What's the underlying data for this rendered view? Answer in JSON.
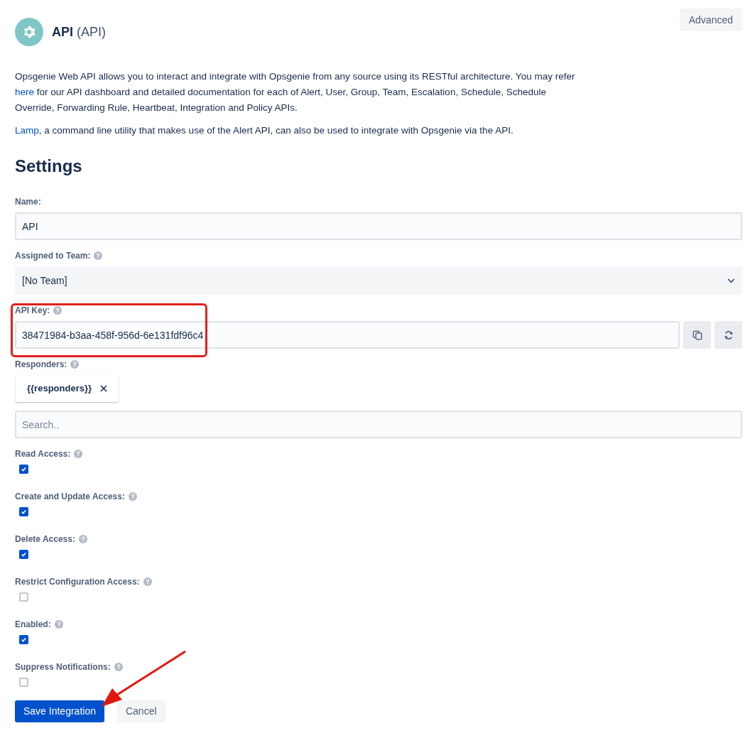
{
  "header": {
    "title": "API",
    "subtitle": "(API)",
    "advanced_button": "Advanced"
  },
  "description": [
    [
      {
        "kind": "text",
        "text": "Opsgenie Web API allows you to interact and integrate with Opsgenie from any source using its RESTful architecture. You may refer "
      },
      {
        "kind": "link",
        "text": "here"
      },
      {
        "kind": "text",
        "text": " for our API dashboard and detailed documentation for each of Alert, User, Group, Team, Escalation, Schedule, Schedule Override, Forwarding Rule, Heartbeat, Integration and Policy APIs."
      }
    ],
    [
      {
        "kind": "link",
        "text": "Lamp"
      },
      {
        "kind": "text",
        "text": ", a command line utility that makes use of the Alert API, can also be used to integrate with Opsgenie via the API."
      }
    ]
  ],
  "settings": {
    "heading": "Settings",
    "fields": [
      {
        "kind": "text",
        "label": "Name:",
        "help": false,
        "value": "API"
      },
      {
        "kind": "select",
        "label": "Assigned to Team:",
        "help": true,
        "value": "[No Team]"
      },
      {
        "kind": "apikey",
        "label": "API Key:",
        "help": true,
        "value": "38471984-b3aa-458f-956d-6e131fdf96c4"
      },
      {
        "kind": "responders",
        "label": "Responders:",
        "help": true,
        "chips": [
          "{{responders}}"
        ],
        "placeholder": "Search.."
      },
      {
        "kind": "checkbox",
        "label": "Read Access:",
        "help": true,
        "checked": true
      },
      {
        "kind": "checkbox",
        "label": "Create and Update Access:",
        "help": true,
        "checked": true
      },
      {
        "kind": "checkbox",
        "label": "Delete Access:",
        "help": true,
        "checked": true
      },
      {
        "kind": "checkbox",
        "label": "Restrict Configuration Access:",
        "help": true,
        "checked": false
      },
      {
        "kind": "checkbox",
        "label": "Enabled:",
        "help": true,
        "checked": true
      },
      {
        "kind": "checkbox",
        "label": "Suppress Notifications:",
        "help": true,
        "checked": false
      }
    ]
  },
  "buttons": [
    {
      "kind": "primary",
      "label": "Save Integration"
    },
    {
      "kind": "secondary",
      "label": "Cancel"
    }
  ]
}
